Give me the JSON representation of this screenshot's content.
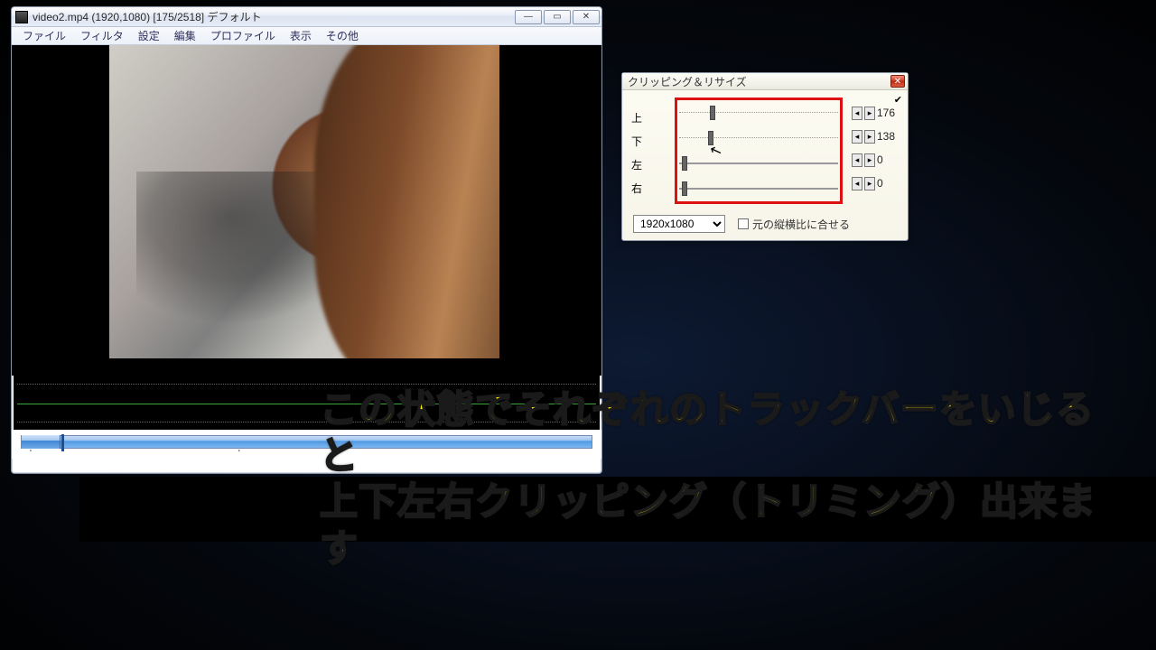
{
  "main_window": {
    "title": "video2.mp4 (1920,1080)  [175/2518]  デフォルト",
    "menu": [
      "ファイル",
      "フィルタ",
      "設定",
      "編集",
      "プロファイル",
      "表示",
      "その他"
    ]
  },
  "clip_dialog": {
    "title": "クリッピング＆リサイズ",
    "rows": [
      {
        "label": "上",
        "value": "176",
        "thumb_pct": 20,
        "dotted": true
      },
      {
        "label": "下",
        "value": "138",
        "thumb_pct": 19,
        "dotted": true
      },
      {
        "label": "左",
        "value": "0",
        "thumb_pct": 2,
        "dotted": false
      },
      {
        "label": "右",
        "value": "0",
        "thumb_pct": 2,
        "dotted": false
      }
    ],
    "size_value": "1920x1080",
    "aspect_label": "元の縦横比に合せる"
  },
  "subtitle": {
    "line1": "この状態でそれぞれのトラックバーをいじると",
    "line2": "上下左右クリッピング（トリミング）出来ます"
  }
}
